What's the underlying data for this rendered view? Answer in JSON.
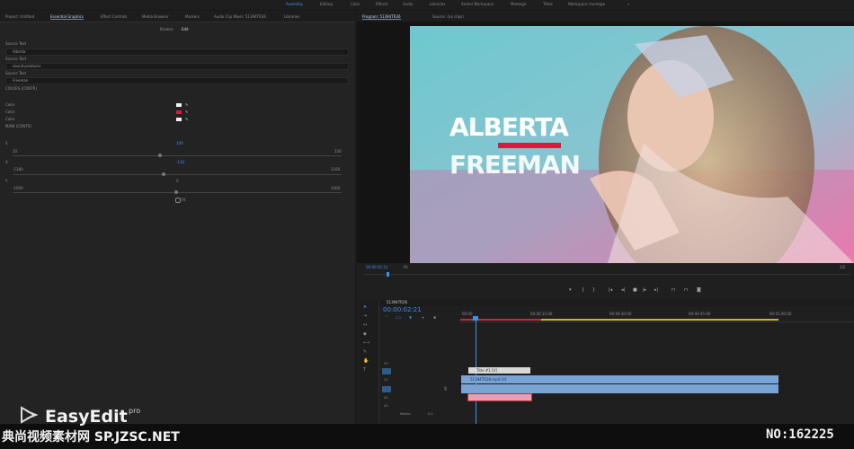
{
  "workspaces": [
    "Assembly",
    "Editing",
    "Color",
    "Effects",
    "Audio",
    "Libraries",
    "Andrei Workspace",
    "Montage",
    "Titles",
    "Workspace montage",
    "»"
  ],
  "active_workspace_index": 0,
  "left_tabs": [
    "Project: Untitled",
    "Essential Graphics",
    "Effect Controls",
    "Media Browser",
    "Markers",
    "Audio Clip Mixer: 51394TR26",
    "Libraries"
  ],
  "active_left_tab_index": 1,
  "browse_edit": {
    "browse": "Browse",
    "edit": "Edit"
  },
  "essential": {
    "source1_label": "Source Text",
    "source1_value": "Alberta",
    "source2_label": "Source Text",
    "source2_value": "sound producer",
    "source3_label": "Source Text",
    "source3_value": "Freeman",
    "colors_header": "COLORS (CONTR)",
    "color_labels": [
      "Color",
      "Color",
      "Color"
    ],
    "swatch_colors": [
      "#f2f2f2",
      "#e0173d",
      "#f2f2f2"
    ],
    "main_header": "MAIN (CONTR)",
    "s1_label": "S",
    "s1_value": "100",
    "s1_min": "20",
    "s1_max": "230",
    "s2_label": "X",
    "s2_value": "-110",
    "s2_min": "-1180",
    "s2_max": "1160",
    "s3_label": "Y",
    "s3_value": "0",
    "s3_min": "-1000",
    "s3_max": "1000",
    "checkbox_label": "Fit"
  },
  "program_tabs": [
    "Program: 51394TR26",
    "Source: (no clips)"
  ],
  "video": {
    "title_line1": "ALBERTA",
    "title_line2": "FREEMAN",
    "accent": "#e0173d"
  },
  "program_timecode": "00:00:02:21",
  "fit_label": "Fit",
  "full_label": "1/2",
  "timeline": {
    "sequence_name": "51394TR26",
    "timecode": "00:00:02:21",
    "ruler": [
      "00:00",
      "00:00:15:00",
      "00:00:30:00",
      "00:00:45:00",
      "00:01:00:00"
    ],
    "tracks_video": [
      "V3",
      "V2",
      "V1"
    ],
    "tracks_audio": [
      "A1",
      "A2",
      "A3"
    ],
    "master_label": "Master",
    "master_value": "0.0",
    "clips": [
      {
        "name": "Title #1 [V]",
        "color": "#d8d8d8"
      },
      {
        "name": "51394TR26.mp4 [V]",
        "color": "#7aa3d6"
      },
      {
        "name": "",
        "color": "#7aa3d6"
      },
      {
        "name": "",
        "color": "#e1a3b3"
      }
    ]
  },
  "watermark": {
    "brand": "EasyEdit",
    "brand_suffix": "pro",
    "site": "典尚视频素材网 SP.JZSC.NET",
    "number": "NO:162225"
  }
}
